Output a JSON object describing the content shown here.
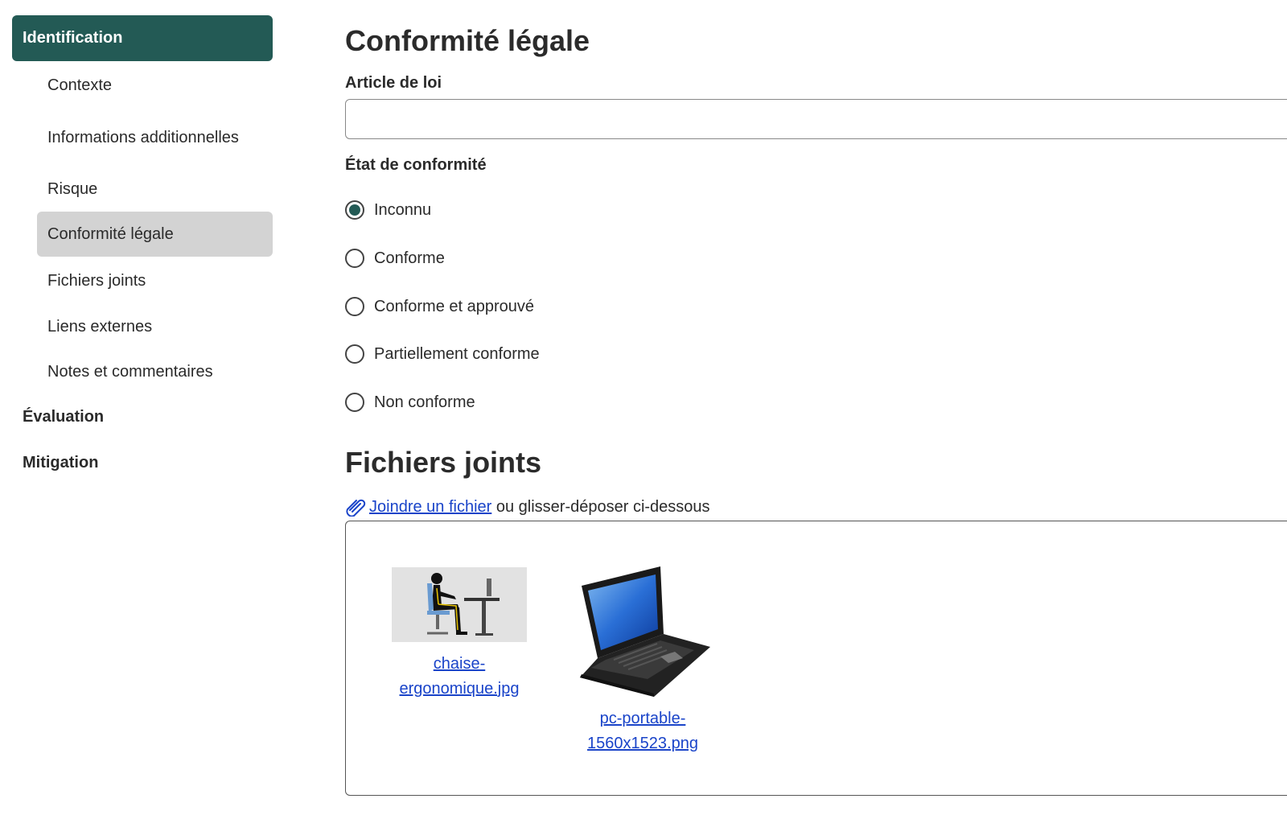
{
  "sidebar": {
    "active_section": "Identification",
    "sub_items": [
      {
        "label": "Contexte"
      },
      {
        "label": "Informations additionnelles"
      },
      {
        "label": "Risque"
      },
      {
        "label": "Conformité légale",
        "selected": true
      },
      {
        "label": "Fichiers joints"
      },
      {
        "label": "Liens externes"
      },
      {
        "label": "Notes et commentaires"
      }
    ],
    "sections": [
      "Évaluation",
      "Mitigation"
    ]
  },
  "compliance": {
    "title": "Conformité légale",
    "article_label": "Article de loi",
    "article_value": "",
    "status_label": "État de conformité",
    "options": [
      {
        "label": "Inconnu",
        "checked": true
      },
      {
        "label": "Conforme",
        "checked": false
      },
      {
        "label": "Conforme et approuvé",
        "checked": false
      },
      {
        "label": "Partiellement conforme",
        "checked": false
      },
      {
        "label": "Non conforme",
        "checked": false
      }
    ]
  },
  "attachments": {
    "title": "Fichiers joints",
    "attach_link": "Joindre un fichier",
    "attach_hint": " ou glisser-déposer ci-dessous",
    "files": [
      {
        "name_line1": "chaise-",
        "name_line2": "ergonomique.jpg",
        "icon": "ergonomic-chair-image"
      },
      {
        "name_line1": "pc-portable-",
        "name_line2": "1560x1523.png",
        "icon": "laptop-image"
      }
    ]
  },
  "colors": {
    "accent": "#235a55",
    "selected_bg": "#d3d3d3",
    "link": "#1a44c9"
  }
}
